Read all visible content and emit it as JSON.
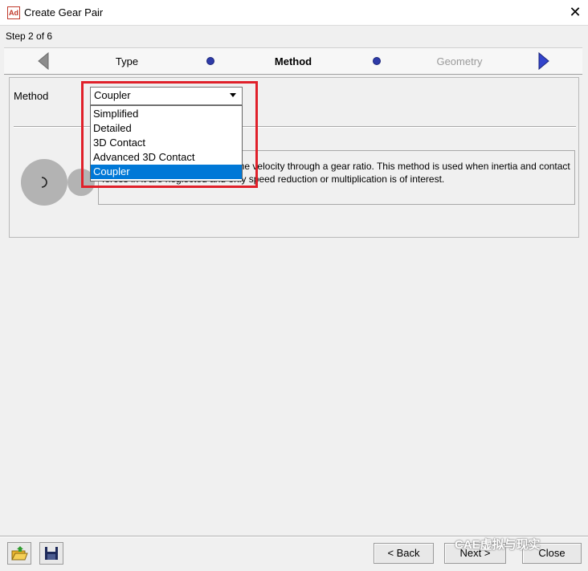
{
  "window": {
    "title": "Create Gear Pair",
    "icon_text": "Ad",
    "close_glyph": "✕"
  },
  "step": {
    "text": "Step 2 of 6"
  },
  "stepnav": {
    "prev_icon": "triangle-left-icon",
    "next_icon": "triangle-right-icon",
    "steps": [
      {
        "label": "Type"
      },
      {
        "label": "Method"
      },
      {
        "label": "Geometry"
      }
    ]
  },
  "method": {
    "label": "Method",
    "selected": "Coupler",
    "options": [
      "Simplified",
      "Detailed",
      "3D Contact",
      "Advanced 3D Contact",
      "Coupler"
    ]
  },
  "description": {
    "text": "The coupler is used to transmit the velocity through a gear ratio. This method is used when inertia and contact forces in it are neglected and only speed reduction or multiplication is of interest."
  },
  "footer": {
    "back_label": "< Back",
    "next_label": "Next >",
    "close_label": "Close",
    "open_icon": "folder-open-icon",
    "save_icon": "floppy-disk-icon"
  },
  "watermark": {
    "text": "CAE虚拟与现实"
  },
  "colors": {
    "selection": "#0078d7",
    "highlight_frame": "#e0202a",
    "step_dot": "#2e3ba8"
  }
}
